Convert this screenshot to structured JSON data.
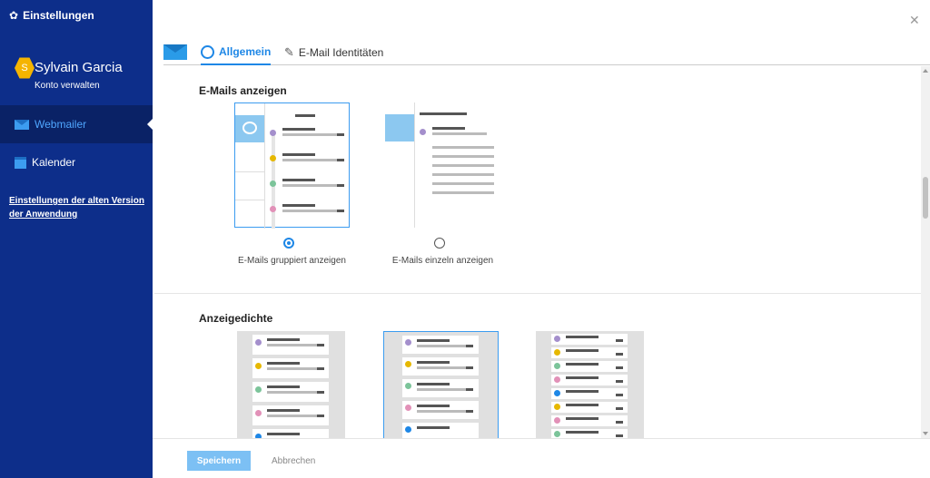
{
  "sidebar": {
    "title": "Einstellungen",
    "user": {
      "initial": "S",
      "name": "Sylvain Garcia",
      "manage": "Konto verwalten"
    },
    "items": [
      {
        "label": "Webmailer",
        "active": true
      },
      {
        "label": "Kalender",
        "active": false
      }
    ],
    "old_link": "Einstellungen der alten Version der Anwendung"
  },
  "tabs": [
    {
      "label": "Allgemein",
      "active": true
    },
    {
      "label": "E-Mail Identitäten",
      "active": false
    }
  ],
  "sections": {
    "display": {
      "title": "E-Mails anzeigen",
      "options": [
        {
          "label": "E-Mails gruppiert anzeigen",
          "selected": true
        },
        {
          "label": "E-Mails einzeln anzeigen",
          "selected": false
        }
      ]
    },
    "density": {
      "title": "Anzeigedichte"
    }
  },
  "footer": {
    "save_label": "Speichern",
    "cancel_label": "Abbrechen"
  },
  "colors": {
    "sidebar": "#0d2e8a",
    "accent": "#1e87e6",
    "avatar": "#f5b400"
  }
}
